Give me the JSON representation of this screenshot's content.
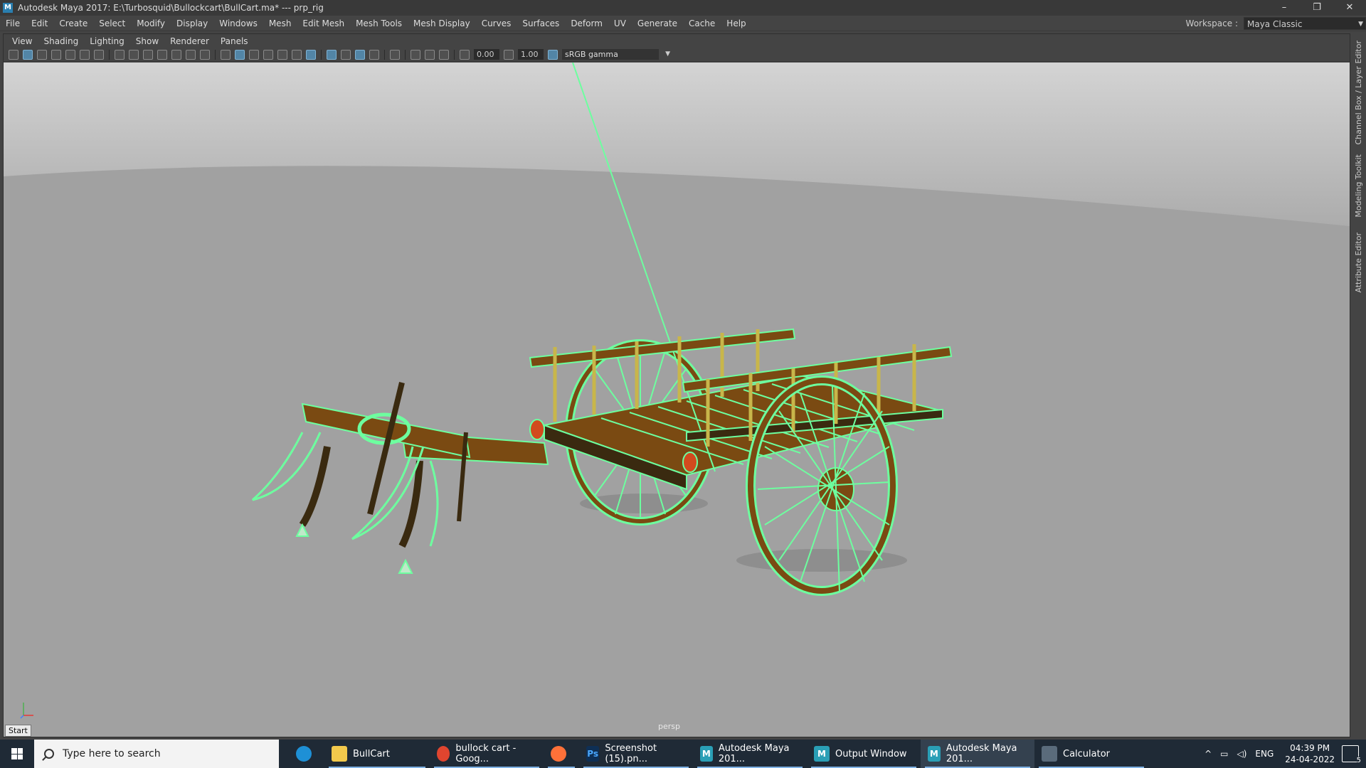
{
  "window": {
    "title": "Autodesk Maya 2017: E:\\Turbosquid\\Bullockcart\\BullCart.ma*   ---   prp_rig",
    "app_icon": "M",
    "controls": [
      "–",
      "❐",
      "✕"
    ]
  },
  "menubar": {
    "items": [
      "File",
      "Edit",
      "Create",
      "Select",
      "Modify",
      "Display",
      "Windows",
      "Mesh",
      "Edit Mesh",
      "Mesh Tools",
      "Mesh Display",
      "Curves",
      "Surfaces",
      "Deform",
      "UV",
      "Generate",
      "Cache",
      "Help"
    ],
    "workspace_label": "Workspace :",
    "workspace_value": "Maya Classic"
  },
  "panel": {
    "menu": [
      "View",
      "Shading",
      "Lighting",
      "Show",
      "Renderer",
      "Panels"
    ],
    "toolbar": {
      "exposure": "0.00",
      "gamma": "1.00",
      "color_space": "sRGB gamma"
    },
    "camera_label": "persp",
    "start_tooltip": "Start"
  },
  "sidetabs": [
    "Channel Box / Layer Editor",
    "Modeling Toolkit",
    "Attribute Editor"
  ],
  "taskbar": {
    "search_placeholder": "Type here to search",
    "tasks": [
      {
        "label": "",
        "icon": "edge-icon",
        "color": "#1e90d6"
      },
      {
        "label": "BullCart",
        "icon": "folder-icon",
        "color": "#f2c94c"
      },
      {
        "label": "bullock cart - Goog...",
        "icon": "chrome-icon",
        "color": "#e0452f"
      },
      {
        "label": "",
        "icon": "firefox-icon",
        "color": "#ff7139"
      },
      {
        "label": "Screenshot (15).pn...",
        "icon": "photoshop-icon",
        "color": "#0e2f55"
      },
      {
        "label": "Autodesk Maya 201...",
        "icon": "maya-icon",
        "color": "#2a9fb6"
      },
      {
        "label": "Output Window",
        "icon": "maya-icon",
        "color": "#2a9fb6"
      },
      {
        "label": "Autodesk Maya 201...",
        "icon": "maya-icon",
        "color": "#2a9fb6"
      },
      {
        "label": "Calculator",
        "icon": "calculator-icon",
        "color": "#5a6b7b"
      }
    ],
    "tray": {
      "language": "ENG",
      "time": "04:39 PM",
      "date": "24-04-2022",
      "notifications": "5"
    }
  },
  "colors": {
    "wire_green": "#6dff9f",
    "wood_brown": "#7a4a12",
    "wood_dark": "#3a2a10"
  }
}
